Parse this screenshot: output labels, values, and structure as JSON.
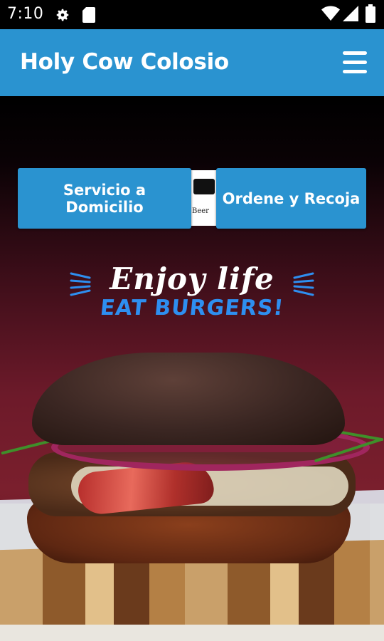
{
  "status_bar": {
    "time": "7:10",
    "icons": [
      "gear-icon",
      "sd-card-icon",
      "wifi-icon",
      "signal-icon",
      "battery-icon"
    ]
  },
  "app_bar": {
    "title": "Holy Cow Colosio",
    "menu_icon": "hamburger-menu-icon",
    "background": "#2a93d0"
  },
  "actions": {
    "delivery_label": "Servicio a Domicilio",
    "pickup_label": "Ordene y Recoja"
  },
  "hero": {
    "slogan_line1": "Enjoy life",
    "slogan_line2": "EAT BURGERS!",
    "logo_text": "Beer",
    "accent": "#2e8ff0"
  }
}
